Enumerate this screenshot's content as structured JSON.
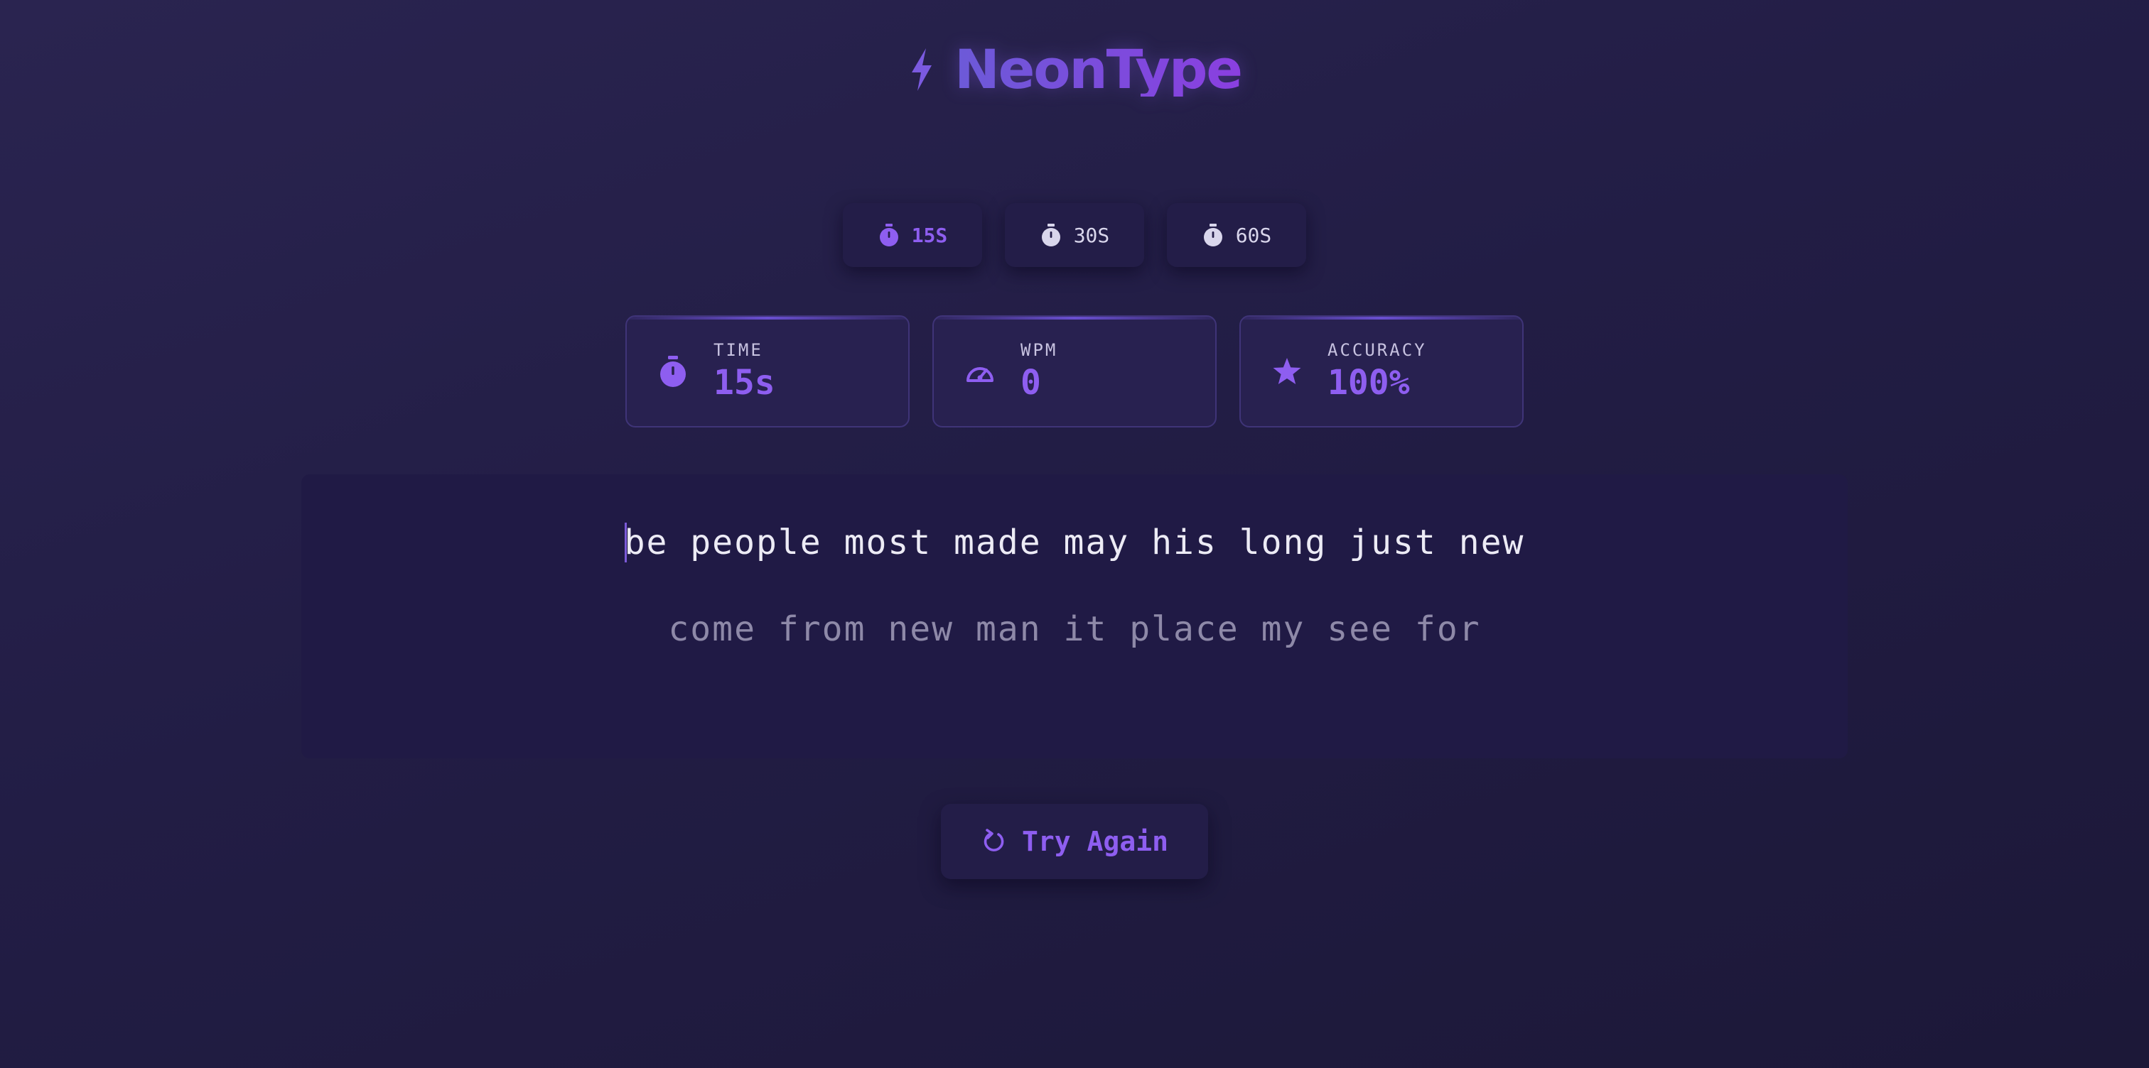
{
  "app": {
    "title": "NeonType"
  },
  "durations": [
    {
      "label": "15S",
      "active": true
    },
    {
      "label": "30S",
      "active": false
    },
    {
      "label": "60S",
      "active": false
    }
  ],
  "stats": {
    "time": {
      "label": "TIME",
      "value": "15s",
      "icon": "stopwatch-icon"
    },
    "wpm": {
      "label": "WPM",
      "value": "0",
      "icon": "speedometer-icon"
    },
    "accuracy": {
      "label": "ACCURACY",
      "value": "100%",
      "icon": "star-icon"
    }
  },
  "typing": {
    "line1": "be people most made may his long just new",
    "line2": "come from new man it place my see for"
  },
  "restart": {
    "label": "Try Again",
    "icon": "refresh-icon"
  },
  "colors": {
    "accent": "#8e5ef0",
    "background": "#241f48",
    "text_typed": "#ecebf5",
    "text_pending": "#8e89a8"
  }
}
